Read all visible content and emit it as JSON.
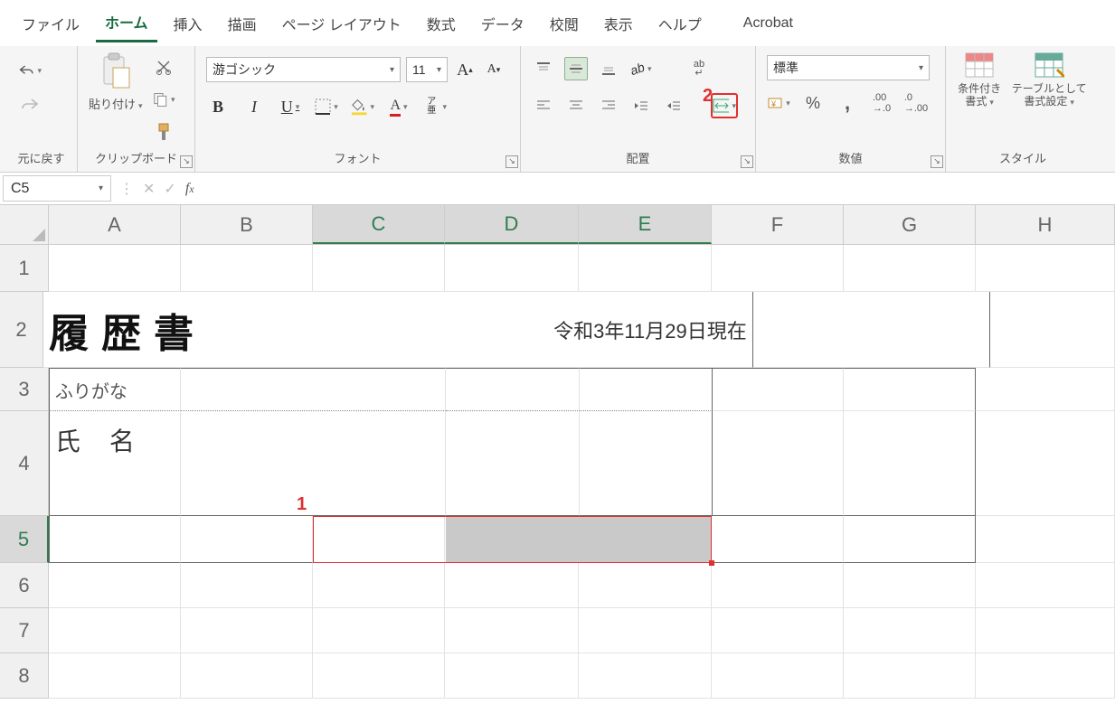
{
  "menu": {
    "tabs": [
      "ファイル",
      "ホーム",
      "挿入",
      "描画",
      "ページ レイアウト",
      "数式",
      "データ",
      "校閲",
      "表示",
      "ヘルプ",
      "Acrobat"
    ],
    "active": 1
  },
  "ribbon": {
    "undo_group": "元に戻す",
    "clipboard_group": "クリップボード",
    "paste_label": "貼り付け",
    "font_group": "フォント",
    "font_name": "游ゴシック",
    "font_size": "11",
    "ruby_label": "ア亜",
    "align_group": "配置",
    "wrap_label": "ab",
    "number_group": "数値",
    "number_format": "標準",
    "styles_group": "スタイル",
    "cond_fmt": "条件付き書式",
    "tbl_fmt": "テーブルとして書式設定"
  },
  "fbar": {
    "name": "C5",
    "formula": ""
  },
  "sheet": {
    "cols": [
      "A",
      "B",
      "C",
      "D",
      "E",
      "F",
      "G",
      "H"
    ],
    "row_count": 8,
    "title": "履歴書",
    "date": "令和3年11月29日現在",
    "furigana": "ふりがな",
    "shimei": "氏名"
  },
  "annot": {
    "one": "1",
    "two": "2"
  }
}
